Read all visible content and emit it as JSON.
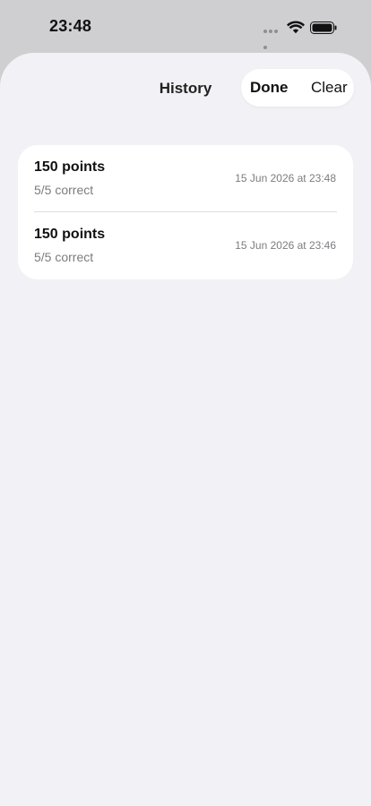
{
  "status_bar": {
    "time": "23:48",
    "icons": [
      "signal-dots-icon",
      "wifi-icon",
      "battery-icon"
    ]
  },
  "nav": {
    "title": "History",
    "done_label": "Done",
    "clear_label": "Clear"
  },
  "history": {
    "items": [
      {
        "points": "150 points",
        "correct": "5/5 correct",
        "date": "15 Jun 2026 at 23:48"
      },
      {
        "points": "150 points",
        "correct": "5/5 correct",
        "date": "15 Jun 2026 at 23:46"
      }
    ]
  },
  "colors": {
    "sheet_background": "#f2f2f6",
    "card_background": "#ffffff",
    "secondary_text": "#7c7c80",
    "status_area": "#cfcfd1"
  }
}
